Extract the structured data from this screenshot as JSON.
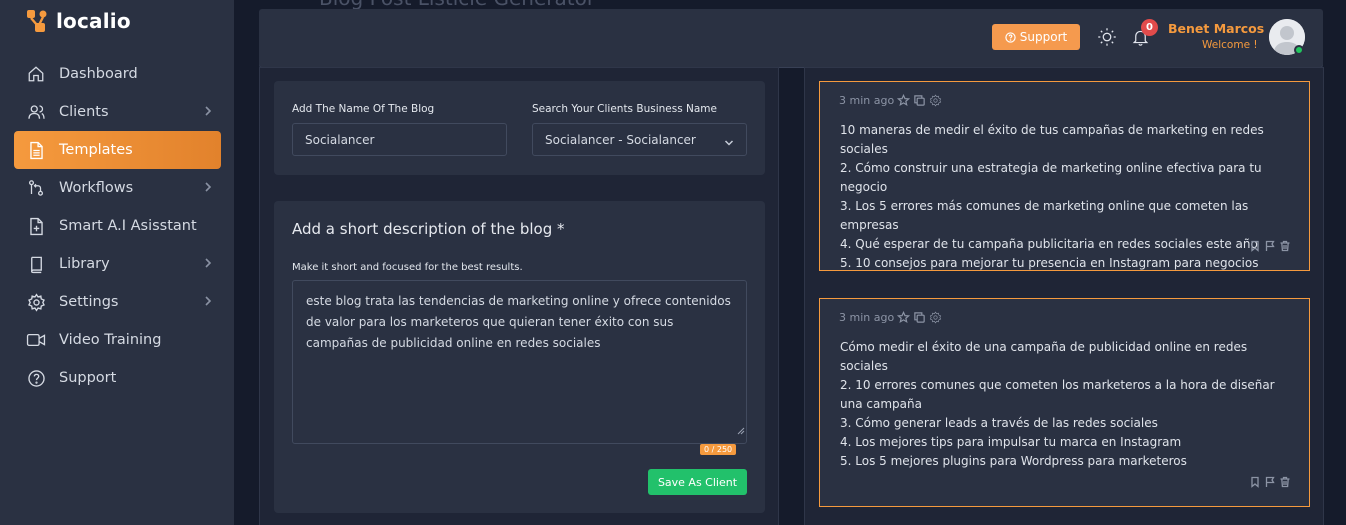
{
  "brand": {
    "name": "localio",
    "accent": "#f59a3e"
  },
  "sidebar": {
    "items": [
      {
        "label": "Dashboard",
        "icon": "home-icon",
        "chevron": false,
        "active": false
      },
      {
        "label": "Clients",
        "icon": "users-icon",
        "chevron": true,
        "active": false
      },
      {
        "label": "Templates",
        "icon": "document-icon",
        "chevron": false,
        "active": true
      },
      {
        "label": "Workflows",
        "icon": "workflow-icon",
        "chevron": true,
        "active": false
      },
      {
        "label": "Smart A.I Asisstant",
        "icon": "file-plus-icon",
        "chevron": false,
        "active": false
      },
      {
        "label": "Library",
        "icon": "book-icon",
        "chevron": true,
        "active": false
      },
      {
        "label": "Settings",
        "icon": "gear-icon",
        "chevron": true,
        "active": false
      },
      {
        "label": "Video Training",
        "icon": "video-icon",
        "chevron": false,
        "active": false
      },
      {
        "label": "Support",
        "icon": "help-circle-icon",
        "chevron": false,
        "active": false
      }
    ]
  },
  "header": {
    "page_title": "Blog Post Listicle Generator",
    "support_label": "Support",
    "notifications_count": "0",
    "user_name": "Benet Marcos",
    "welcome": "Welcome !"
  },
  "form": {
    "blog_name_label": "Add The Name Of The Blog",
    "blog_name_value": "Socialancer",
    "client_label": "Search Your Clients Business Name",
    "client_value": "Socialancer - Socialancer",
    "description_title": "Add a short description of the blog *",
    "description_hint": "Make it short and focused for the best results.",
    "description_value": "este blog trata las tendencias de marketing online y ofrece contenidos de valor para los marketeros que quieran tener éxito con sus campañas de publicidad online en redes sociales",
    "counter": "0 / 250",
    "save_label": "Save As Client"
  },
  "results": [
    {
      "time": "3 min ago",
      "lines": [
        "10 maneras de medir el éxito de tus campañas de marketing en redes sociales",
        "2. Cómo construir una estrategia de marketing online efectiva para tu negocio",
        "3. Los 5 errores más comunes de marketing online que cometen las empresas",
        "4. Qué esperar de tu campaña publicitaria en redes sociales este año",
        "5. 10 consejos para mejorar tu presencia en Instagram para negocios"
      ]
    },
    {
      "time": "3 min ago",
      "lines": [
        "Cómo medir el éxito de una campaña de publicidad online en redes sociales",
        "2. 10 errores comunes que cometen los marketeros a la hora de diseñar una campaña",
        "3. Cómo generar leads a través de las redes sociales",
        "4. Los mejores tips para impulsar tu marca en Instagram",
        "5. Los 5 mejores plugins para Wordpress para marketeros"
      ]
    }
  ]
}
